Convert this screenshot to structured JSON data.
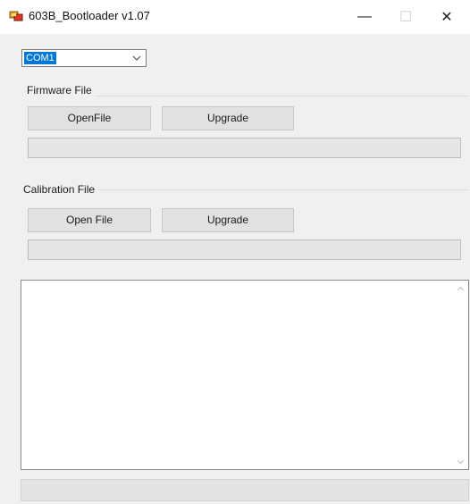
{
  "window": {
    "title": "603B_Bootloader v1.07",
    "icon": "app-icon",
    "controls": {
      "minimize": "—",
      "maximize": "☐",
      "close": "✕"
    }
  },
  "port": {
    "selected": "COM1"
  },
  "firmware": {
    "group_label": "Firmware File",
    "open_label": "OpenFile",
    "upgrade_label": "Upgrade",
    "progress": 0
  },
  "calibration": {
    "group_label": "Calibration File",
    "open_label": "Open File",
    "upgrade_label": "Upgrade",
    "progress": 0
  },
  "log": {
    "text": ""
  },
  "status": {
    "text": ""
  },
  "colors": {
    "selection": "#0078d7",
    "window_bg": "#f0f0f0",
    "button_bg": "#e1e1e1"
  }
}
